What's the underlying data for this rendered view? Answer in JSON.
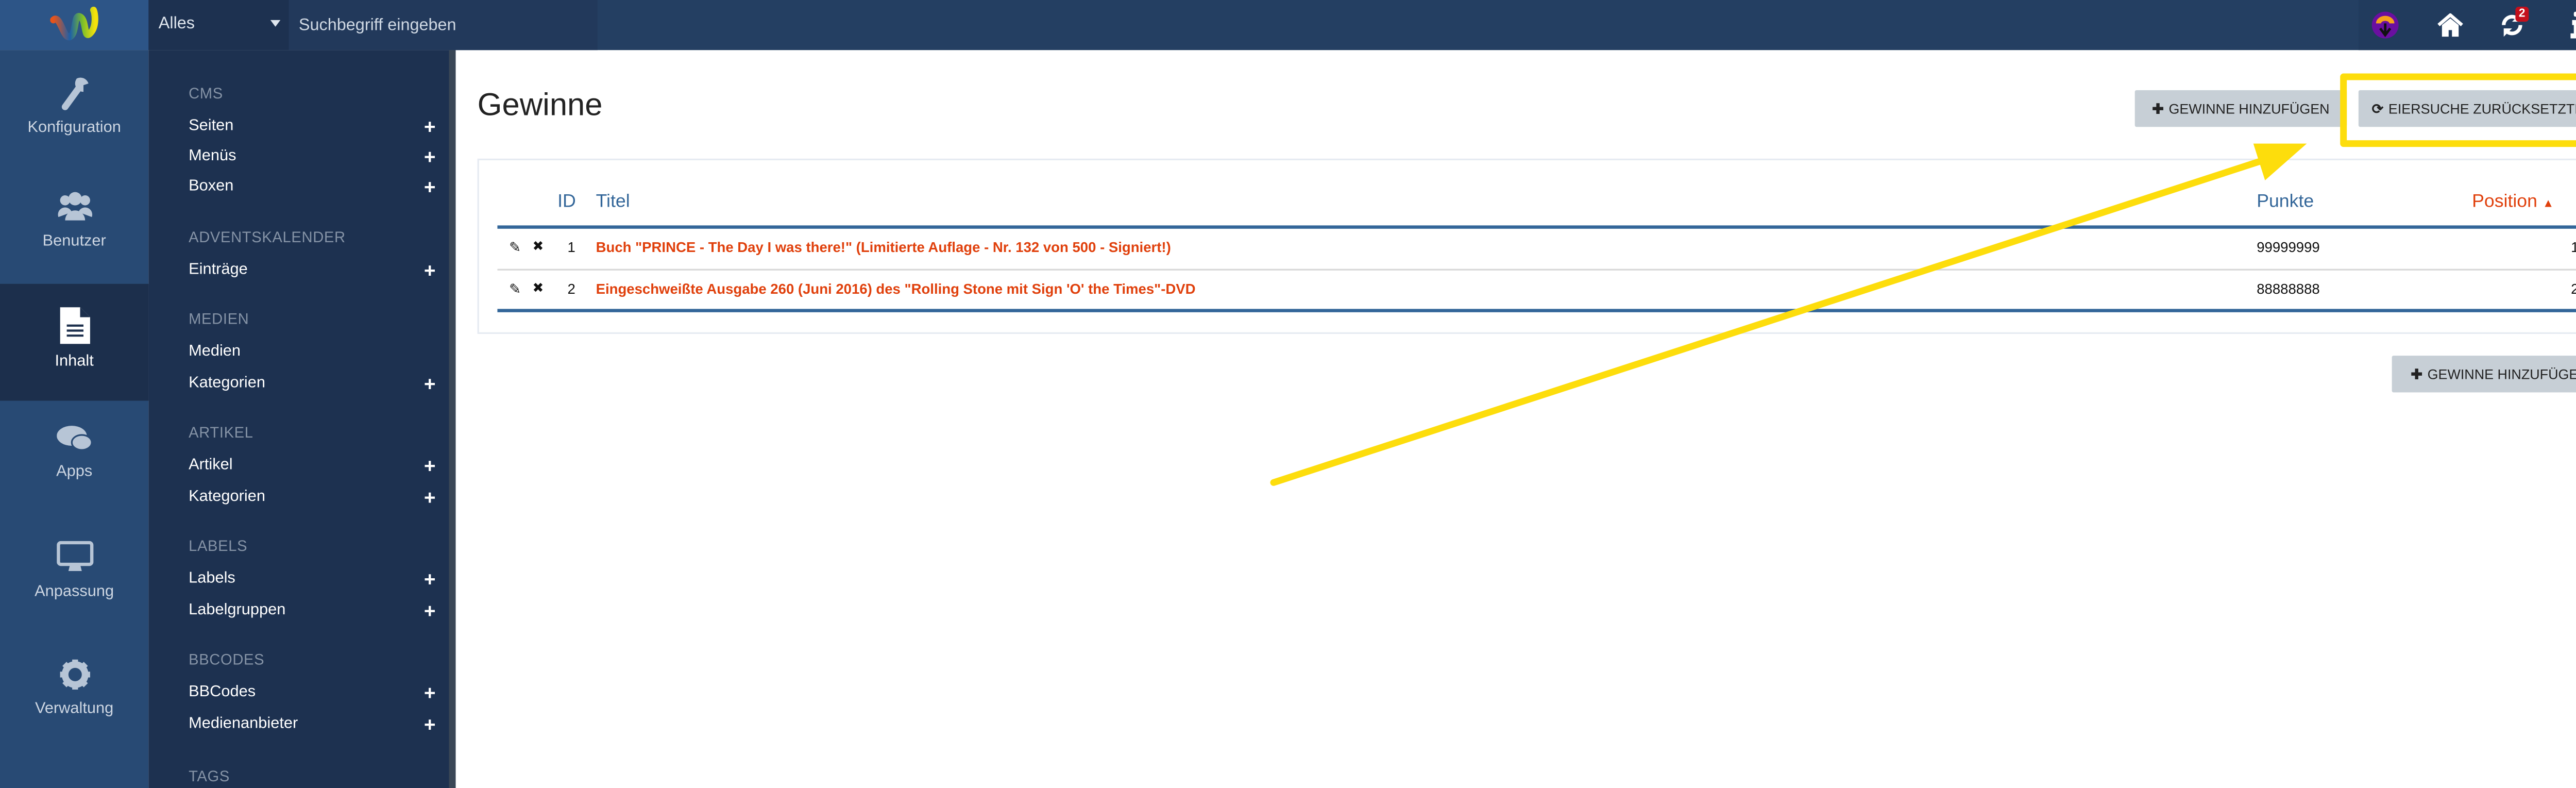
{
  "topbar": {
    "scope_select": "Alles",
    "search_placeholder": "Suchbegriff eingeben",
    "icons": [
      "admin-avatar-icon",
      "home-icon",
      "sync-icon",
      "info-icon"
    ],
    "sync_badge": "2"
  },
  "nav": {
    "items": [
      {
        "label": "Konfiguration",
        "icon": "wrench-icon"
      },
      {
        "label": "Benutzer",
        "icon": "users-icon"
      },
      {
        "label": "Inhalt",
        "icon": "file-icon",
        "active": true
      },
      {
        "label": "Apps",
        "icon": "comments-icon"
      },
      {
        "label": "Anpassung",
        "icon": "desktop-icon"
      },
      {
        "label": "Verwaltung",
        "icon": "gear-icon"
      }
    ]
  },
  "submenu": {
    "sections": [
      {
        "title": "CMS",
        "items": [
          {
            "label": "Seiten",
            "plus": true
          },
          {
            "label": "Menüs",
            "plus": true
          },
          {
            "label": "Boxen",
            "plus": true
          }
        ]
      },
      {
        "title": "ADVENTSKALENDER",
        "items": [
          {
            "label": "Einträge",
            "plus": true
          }
        ]
      },
      {
        "title": "MEDIEN",
        "items": [
          {
            "label": "Medien",
            "plus": false
          },
          {
            "label": "Kategorien",
            "plus": true
          }
        ]
      },
      {
        "title": "ARTIKEL",
        "items": [
          {
            "label": "Artikel",
            "plus": true
          },
          {
            "label": "Kategorien",
            "plus": true
          }
        ]
      },
      {
        "title": "LABELS",
        "items": [
          {
            "label": "Labels",
            "plus": true
          },
          {
            "label": "Labelgruppen",
            "plus": true
          }
        ]
      },
      {
        "title": "BBCODES",
        "items": [
          {
            "label": "BBCodes",
            "plus": true
          },
          {
            "label": "Medienanbieter",
            "plus": true
          }
        ]
      },
      {
        "title": "TAGS",
        "items": []
      }
    ]
  },
  "main": {
    "title": "Gewinne",
    "add_button": "GEWINNE HINZUFÜGEN",
    "reset_button": "EIERSUCHE ZURÜCKSETZTEN",
    "table": {
      "headers": {
        "id": "ID",
        "title": "Titel",
        "points": "Punkte",
        "position": "Position"
      },
      "sort": "position-ascending",
      "rows": [
        {
          "id": "1",
          "title": "Buch \"PRINCE - The Day I was there!\" (Limitierte Auflage - Nr. 132 von 500 - Signiert!)",
          "points": "99999999",
          "position": "1"
        },
        {
          "id": "2",
          "title": "Eingeschweißte Ausgabe 260 (Juni 2016) des \"Rolling Stone mit Sign 'O' the Times\"-DVD",
          "points": "88888888",
          "position": "2"
        }
      ]
    },
    "add_button_bottom": "GEWINNE HINZUFÜGEN"
  },
  "colors": {
    "accent_red": "#e0400c",
    "header_blue": "#336699",
    "highlight_yellow": "#fddd0c",
    "nav_bg": "#284a74",
    "submenu_bg": "#1d3150"
  }
}
